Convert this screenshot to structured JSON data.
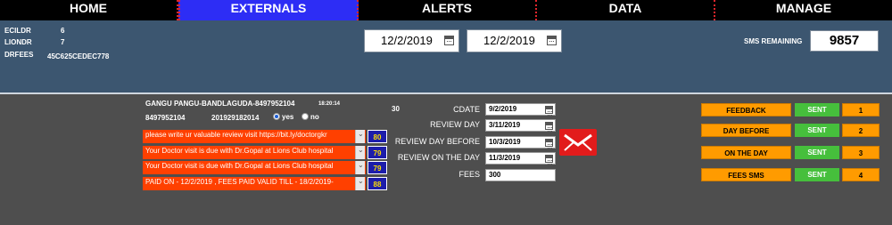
{
  "nav": {
    "items": [
      "HOME",
      "EXTERNALS",
      "ALERTS",
      "DATA",
      "MANAGE"
    ],
    "active": "EXTERNALS"
  },
  "info": {
    "ecildr_label": "ECILDR",
    "ecildr_value": "6",
    "lion_label": "LIONDR",
    "lion_value": "7",
    "drfees_label": "DRFEES",
    "drfees_value": "45C625CEDEC778"
  },
  "dates": {
    "from": "12/2/2019",
    "to": "12/2/2019"
  },
  "sms": {
    "label": "SMS REMAINING",
    "value": "9857"
  },
  "patient": {
    "name_line": "GANGU PANGU-BANDLAGUDA-8497952104",
    "time": "18:20:14",
    "phone": "8497952104",
    "id": "201929182014",
    "count": "30",
    "yes_label": "yes",
    "no_label": "no"
  },
  "messages": [
    {
      "text": "please  write ur valuable review visit https://bit.ly/doctorgkr",
      "count": "80"
    },
    {
      "text": "Your Doctor visit is due with Dr.Gopal at Lions Club hospital",
      "count": "79"
    },
    {
      "text": "Your Doctor visit is due with Dr.Gopal at Lions Club hospital",
      "count": "79"
    },
    {
      "text": " PAID ON - 12/2/2019 , FEES PAID VALID TILL - 18/2/2019-",
      "count": "88"
    }
  ],
  "fields": {
    "cdate_label": "CDATE",
    "cdate": "9/2/2019",
    "review_day_label": "REVIEW DAY",
    "review_day": "3/11/2019",
    "review_before_label": "REVIEW DAY BEFORE",
    "review_before": "10/3/2019",
    "review_on_label": "REVIEW ON THE DAY",
    "review_on": "11/3/2019",
    "fees_label": "FEES",
    "fees": "300"
  },
  "actions": [
    {
      "label": "FEEDBACK",
      "status": "SENT",
      "num": "1"
    },
    {
      "label": "DAY BEFORE",
      "status": "SENT",
      "num": "2"
    },
    {
      "label": "ON THE DAY",
      "status": "SENT",
      "num": "3"
    },
    {
      "label": "FEES SMS",
      "status": "SENT",
      "num": "4"
    }
  ],
  "colors": {
    "accent_nav": "#2d2df5",
    "message_bg": "#ff4000",
    "action_bg": "#ff9b00",
    "sent_bg": "#46bf3c",
    "send_icon": "#e21b1b"
  }
}
